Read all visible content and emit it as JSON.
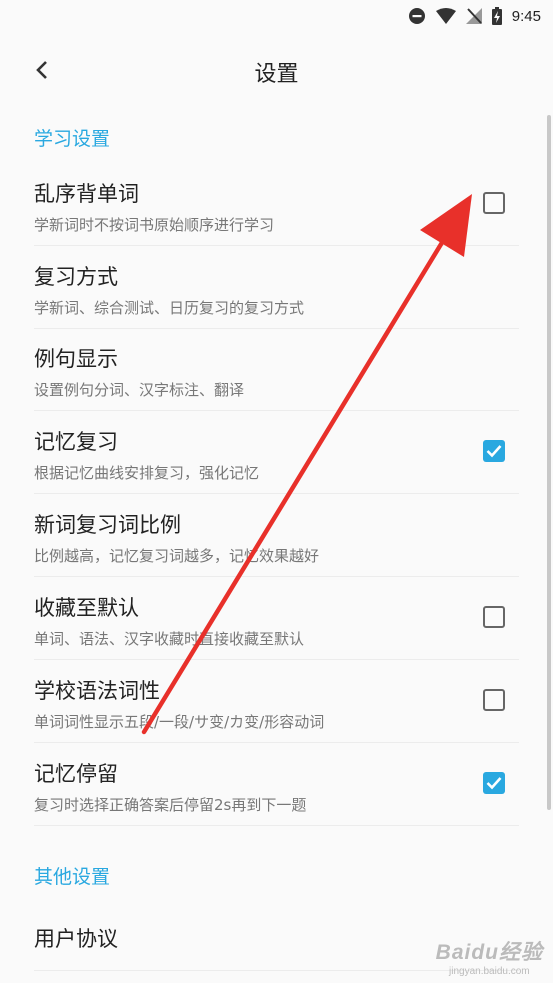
{
  "status_bar": {
    "time": "9:45"
  },
  "header": {
    "title": "设置"
  },
  "sections": {
    "study": "学习设置",
    "other": "其他设置"
  },
  "settings": [
    {
      "title": "乱序背单词",
      "subtitle": "学新词时不按词书原始顺序进行学习",
      "checkbox": "unchecked"
    },
    {
      "title": "复习方式",
      "subtitle": "学新词、综合测试、日历复习的复习方式",
      "checkbox": "none"
    },
    {
      "title": "例句显示",
      "subtitle": "设置例句分词、汉字标注、翻译",
      "checkbox": "none"
    },
    {
      "title": "记忆复习",
      "subtitle": "根据记忆曲线安排复习，强化记忆",
      "checkbox": "checked"
    },
    {
      "title": "新词复习词比例",
      "subtitle": "比例越高，记忆复习词越多，记忆效果越好",
      "checkbox": "none"
    },
    {
      "title": "收藏至默认",
      "subtitle": "单词、语法、汉字收藏时直接收藏至默认",
      "checkbox": "unchecked"
    },
    {
      "title": "学校语法词性",
      "subtitle": "单词词性显示五段/一段/サ变/カ变/形容动词",
      "checkbox": "unchecked"
    },
    {
      "title": "记忆停留",
      "subtitle": "复习时选择正确答案后停留2s再到下一题",
      "checkbox": "checked"
    }
  ],
  "other_settings": [
    {
      "title": "用户协议"
    }
  ],
  "colors": {
    "accent": "#29a8e0",
    "annotation_arrow": "#e8302a"
  },
  "watermark": {
    "logo": "Baidu经验",
    "sub": "jingyan.baidu.com"
  }
}
